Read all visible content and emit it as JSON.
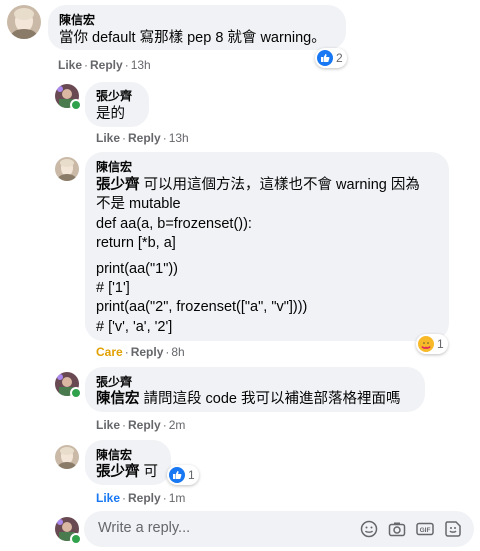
{
  "comments": [
    {
      "author": "陳信宏",
      "text": "當你 default 寫那樣 pep 8 就會 warning。",
      "actions": {
        "like": "Like",
        "reply": "Reply",
        "time": "13h"
      },
      "reaction_count": "2"
    },
    {
      "author": "張少齊",
      "text": "是的",
      "actions": {
        "like": "Like",
        "reply": "Reply",
        "time": "13h"
      }
    },
    {
      "author": "陳信宏",
      "mention": "張少齊",
      "line1": " 可以用這個方法，這樣也不會 warning 因為",
      "line2": "不是 mutable",
      "code1": "def aa(a, b=frozenset()):",
      "code2": "return [*b, a]",
      "code3": "print(aa(\"1\"))",
      "code4": "# ['1']",
      "code5": "print(aa(\"2\", frozenset([\"a\", \"v\"])))",
      "code6": "# ['v', 'a', '2']",
      "actions": {
        "like": "Care",
        "reply": "Reply",
        "time": "8h"
      },
      "reaction_count": "1"
    },
    {
      "author": "張少齊",
      "mention": "陳信宏",
      "text": " 請問這段 code 我可以補進部落格裡面嗎",
      "actions": {
        "like": "Like",
        "reply": "Reply",
        "time": "2m"
      }
    },
    {
      "author": "陳信宏",
      "mention": "張少齊",
      "text": " 可",
      "actions": {
        "like": "Like",
        "reply": "Reply",
        "time": "1m"
      },
      "reaction_count": "1"
    }
  ],
  "reply_box": {
    "placeholder": "Write a reply..."
  },
  "colors": {
    "like_blue": "#1877f2",
    "care_yellow": "#e2a100",
    "bubble_bg": "#f0f2f5",
    "meta_gray": "#65676b"
  }
}
